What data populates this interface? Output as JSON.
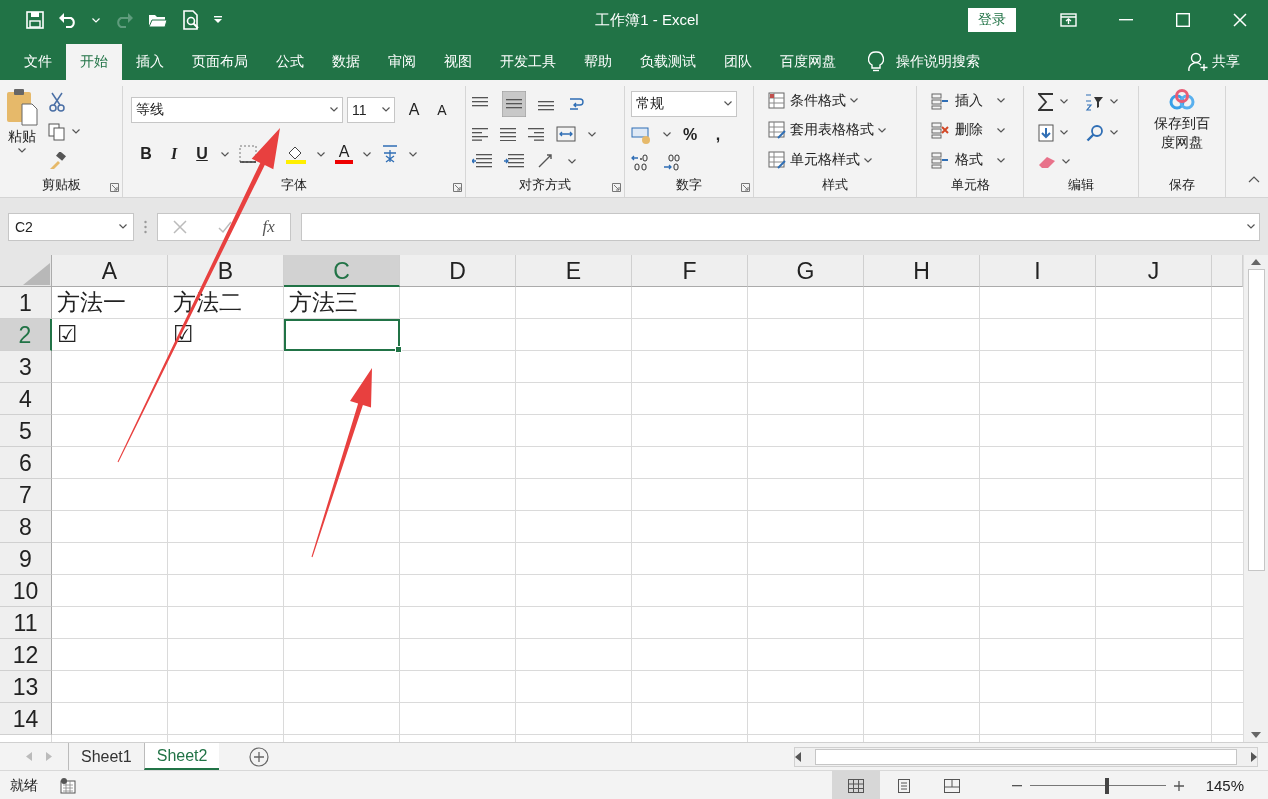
{
  "title_bar": {
    "title": "工作簿1 - Excel",
    "sign_in": "登录"
  },
  "menu_tabs": [
    {
      "label": "文件",
      "selected": false
    },
    {
      "label": "开始",
      "selected": true
    },
    {
      "label": "插入",
      "selected": false
    },
    {
      "label": "页面布局",
      "selected": false
    },
    {
      "label": "公式",
      "selected": false
    },
    {
      "label": "数据",
      "selected": false
    },
    {
      "label": "审阅",
      "selected": false
    },
    {
      "label": "视图",
      "selected": false
    },
    {
      "label": "开发工具",
      "selected": false
    },
    {
      "label": "帮助",
      "selected": false
    },
    {
      "label": "负载测试",
      "selected": false
    },
    {
      "label": "团队",
      "selected": false
    },
    {
      "label": "百度网盘",
      "selected": false
    }
  ],
  "tell_me": "操作说明搜索",
  "share": "共享",
  "ribbon": {
    "clipboard": {
      "paste": "粘贴",
      "label": "剪贴板"
    },
    "font": {
      "name": "等线",
      "size": "11",
      "grow": "A",
      "shrink": "A",
      "bold": "B",
      "italic": "I",
      "underline": "U",
      "color_letter": "A",
      "label": "字体"
    },
    "alignment": {
      "label": "对齐方式"
    },
    "number": {
      "format": "常规",
      "percent": "%",
      "comma": ",",
      "label": "数字"
    },
    "styles": {
      "items": [
        "条件格式",
        "套用表格格式",
        "单元格样式"
      ],
      "label": "样式"
    },
    "cells": {
      "items": [
        "插入",
        "删除",
        "格式"
      ],
      "label": "单元格"
    },
    "editing": {
      "label": "编辑"
    },
    "save": {
      "button": "保存到百度网盘",
      "label": "保存"
    }
  },
  "formula_bar": {
    "name_box": "C2",
    "function_label": "fx"
  },
  "sheet": {
    "columns": [
      {
        "label": "A",
        "selected": false
      },
      {
        "label": "B",
        "selected": false
      },
      {
        "label": "C",
        "selected": true
      },
      {
        "label": "D",
        "selected": false
      },
      {
        "label": "E",
        "selected": false
      },
      {
        "label": "F",
        "selected": false
      },
      {
        "label": "G",
        "selected": false
      },
      {
        "label": "H",
        "selected": false
      },
      {
        "label": "I",
        "selected": false
      },
      {
        "label": "J",
        "selected": false
      }
    ],
    "rows": [
      {
        "header": "1",
        "selected": false,
        "cells": [
          "方法一",
          "方法二",
          "方法三"
        ]
      },
      {
        "header": "2",
        "selected": true,
        "cells": [
          "☑",
          "☑"
        ]
      },
      {
        "header": "3",
        "selected": false
      },
      {
        "header": "4",
        "selected": false
      },
      {
        "header": "5",
        "selected": false
      },
      {
        "header": "6",
        "selected": false
      },
      {
        "header": "7",
        "selected": false
      },
      {
        "header": "8",
        "selected": false
      },
      {
        "header": "9",
        "selected": false
      },
      {
        "header": "10",
        "selected": false
      },
      {
        "header": "11",
        "selected": false
      },
      {
        "header": "12",
        "selected": false
      },
      {
        "header": "13",
        "selected": false
      },
      {
        "header": "14",
        "selected": false
      }
    ]
  },
  "sheet_tabs": [
    {
      "label": "Sheet1",
      "selected": false
    },
    {
      "label": "Sheet2",
      "selected": true
    }
  ],
  "status_bar": {
    "status": "就绪",
    "zoom": "145%",
    "zoom_slider": {
      "level": 0.57
    },
    "views": [
      {
        "kind": "normal",
        "selected": true
      },
      {
        "kind": "page_layout",
        "selected": false
      },
      {
        "kind": "page_break",
        "selected": false
      }
    ]
  }
}
